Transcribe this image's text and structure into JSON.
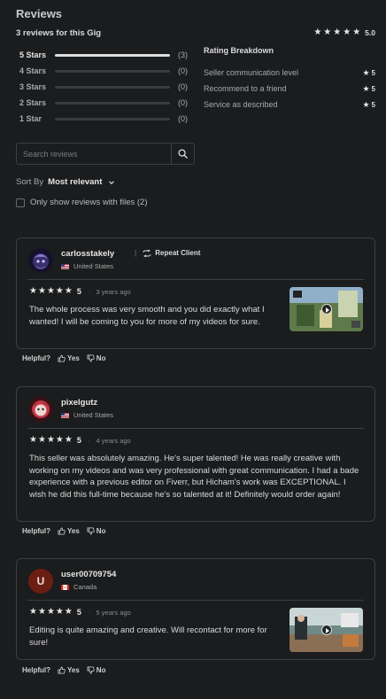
{
  "header": {
    "title": "Reviews",
    "summary": "3 reviews for this Gig",
    "overall_rating": "5.0"
  },
  "star_bars": [
    {
      "label": "5 Stars",
      "count": "(3)",
      "fraction": 1.0
    },
    {
      "label": "4 Stars",
      "count": "(0)",
      "fraction": 0
    },
    {
      "label": "3 Stars",
      "count": "(0)",
      "fraction": 0
    },
    {
      "label": "2 Stars",
      "count": "(0)",
      "fraction": 0
    },
    {
      "label": "1 Star",
      "count": "(0)",
      "fraction": 0
    }
  ],
  "breakdown": {
    "title": "Rating Breakdown",
    "items": [
      {
        "label": "Seller communication level",
        "value": "5"
      },
      {
        "label": "Recommend to a friend",
        "value": "5"
      },
      {
        "label": "Service as described",
        "value": "5"
      }
    ]
  },
  "search": {
    "placeholder": "Search reviews",
    "value": ""
  },
  "sort": {
    "label": "Sort By",
    "value": "Most relevant"
  },
  "filter": {
    "label": "Only show reviews with files (2)",
    "checked": false
  },
  "reviews": [
    {
      "username": "carlosstakely",
      "badge": "Repeat Client",
      "country": "United States",
      "rating": "5",
      "time_ago": "3 years ago",
      "text": "The whole process was very smooth and you did exactly what I wanted! I will be coming to you for more of my videos for sure.",
      "has_media": true
    },
    {
      "username": "pixelgutz",
      "country": "United States",
      "rating": "5",
      "time_ago": "4 years ago",
      "text": "This seller was absolutely amazing. He's super talented! He was really creative with working on my videos and was very professional with great communication. I had a bade experience with a previous editor on Fiverr, but Hicham's work was EXCEPTIONAL. I wish he did this full-time because he's so talented at it! Definitely would order again!",
      "has_media": false
    },
    {
      "username": "user00709754",
      "avatar_letter": "U",
      "country": "Canada",
      "rating": "5",
      "time_ago": "5 years ago",
      "text": "Editing is quite amazing and creative. Will recontact for more for sure!",
      "has_media": true
    }
  ],
  "helpful": {
    "question": "Helpful?",
    "yes": "Yes",
    "no": "No"
  },
  "colors": {
    "background": "#1b1c1d",
    "border": "#3d3e3f",
    "star": "#e6e6e6",
    "text": "#dadbdc"
  },
  "icons": [
    "star-icon",
    "search-icon",
    "chevron-down-icon",
    "thumbs-up-icon",
    "thumbs-down-icon",
    "play-icon",
    "flag-icon"
  ]
}
